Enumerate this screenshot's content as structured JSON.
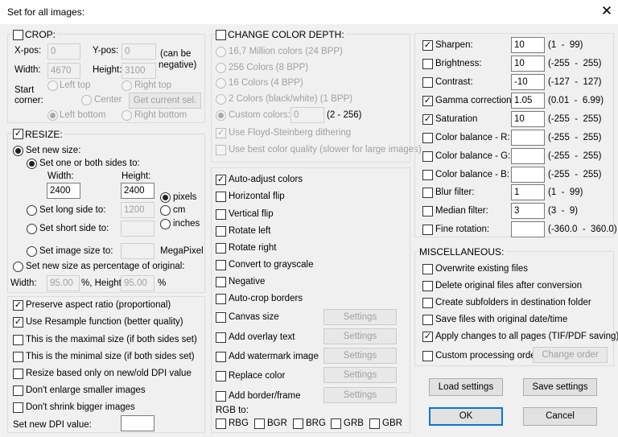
{
  "window": {
    "title": "Set for all images:",
    "close_glyph": "✕"
  },
  "crop": {
    "label": "CROP:",
    "xpos_label": "X-pos:",
    "xpos_value": "0",
    "ypos_label": "Y-pos:",
    "ypos_value": "0",
    "neg_note_1": "(can be",
    "neg_note_2": "negative)",
    "width_label": "Width:",
    "width_value": "4670",
    "height_label": "Height:",
    "height_value": "3100",
    "start_corner_1": "Start",
    "start_corner_2": "corner:",
    "left_top": "Left top",
    "right_top": "Right top",
    "center": "Center",
    "get_current": "Get current sel.",
    "left_bottom": "Left bottom",
    "right_bottom": "Right bottom"
  },
  "resize": {
    "label": "RESIZE:",
    "set_new_size": "Set new size:",
    "one_or_both": "Set one or both sides to:",
    "width_label": "Width:",
    "width_value": "2400",
    "height_label": "Height:",
    "height_value": "2400",
    "pixels": "pixels",
    "cm": "cm",
    "inches": "inches",
    "long_side": "Set long side to:",
    "long_side_value": "1200",
    "short_side": "Set short side to:",
    "image_size": "Set image size to:",
    "megapixel": "MegaPixel",
    "percentage": "Set new size as percentage of original:",
    "pct_width_label": "Width:",
    "pct_width_value": "95.00",
    "pct_height_label": "%, Height:",
    "pct_height_value": "95.00",
    "pct_suffix": "%"
  },
  "resize_options": {
    "preserve": "Preserve aspect ratio (proportional)",
    "resample": "Use Resample function (better quality)",
    "maximal": "This is the maximal size (if both sides set)",
    "minimal": "This is the minimal size (if both sides set)",
    "dpi_based": "Resize based only on new/old DPI value",
    "no_enlarge": "Don't enlarge smaller images",
    "no_shrink": "Don't shrink bigger images",
    "dpi_label": "Set new DPI value:",
    "dpi_value": ""
  },
  "color_depth": {
    "label": "CHANGE COLOR DEPTH:",
    "options": [
      "16,7 Million colors (24 BPP)",
      "256 Colors (8 BPP)",
      "16 Colors (4 BPP)",
      "2 Colors (black/white) (1 BPP)"
    ],
    "custom": "Custom colors:",
    "custom_value": "0",
    "custom_range": "(2 - 256)",
    "floyd": "Use Floyd-Steinberg dithering",
    "best_quality": "Use best color quality (slower for large images)"
  },
  "mid_options": {
    "items": [
      "Auto-adjust colors",
      "Horizontal flip",
      "Vertical flip",
      "Rotate left",
      "Rotate right",
      "Convert to grayscale",
      "Negative",
      "Auto-crop borders"
    ],
    "with_settings": [
      "Canvas size",
      "Add overlay text",
      "Add watermark image",
      "Replace color",
      "Add border/frame"
    ],
    "settings_label": "Settings",
    "rgb_label": "RGB to:",
    "rgb_options": [
      "RBG",
      "BGR",
      "BRG",
      "GRB",
      "GBR"
    ]
  },
  "adjustments": {
    "rows": [
      {
        "label": "Sharpen:",
        "value": "10",
        "range": "(1  -  99)",
        "checked": true
      },
      {
        "label": "Brightness:",
        "value": "10",
        "range": "(-255  -  255)",
        "checked": false
      },
      {
        "label": "Contrast:",
        "value": "-10",
        "range": "(-127  -  127)",
        "checked": false
      },
      {
        "label": "Gamma correction:",
        "value": "1.05",
        "range": "(0.01  -  6.99)",
        "checked": true
      },
      {
        "label": "Saturation",
        "value": "10",
        "range": "(-255  -  255)",
        "checked": true
      },
      {
        "label": "Color balance - R:",
        "value": "",
        "range": "(-255  -  255)",
        "checked": false
      },
      {
        "label": "Color balance - G:",
        "value": "",
        "range": "(-255  -  255)",
        "checked": false
      },
      {
        "label": "Color balance - B:",
        "value": "",
        "range": "(-255  -  255)",
        "checked": false
      },
      {
        "label": "Blur filter:",
        "value": "1",
        "range": "(1  -  99)",
        "checked": false
      },
      {
        "label": "Median filter:",
        "value": "3",
        "range": "(3  -  9)",
        "checked": false
      },
      {
        "label": "Fine rotation:",
        "value": "",
        "range": "(-360.0  -  360.0)",
        "checked": false
      }
    ]
  },
  "misc": {
    "label": "MISCELLANEOUS:",
    "overwrite": "Overwrite existing files",
    "delete_original": "Delete original files after conversion",
    "create_subfolders": "Create subfolders in destination folder",
    "save_datetime": "Save files with original date/time",
    "apply_all_pages": "Apply changes to all pages (TIF/PDF saving)",
    "custom_order": "Custom processing order",
    "change_order": "Change order"
  },
  "buttons": {
    "load": "Load settings",
    "save": "Save settings",
    "ok": "OK",
    "cancel": "Cancel"
  },
  "colors": {
    "accent": "#0078d7",
    "check": "#000000",
    "disabled_text": "#a0a0a0"
  }
}
